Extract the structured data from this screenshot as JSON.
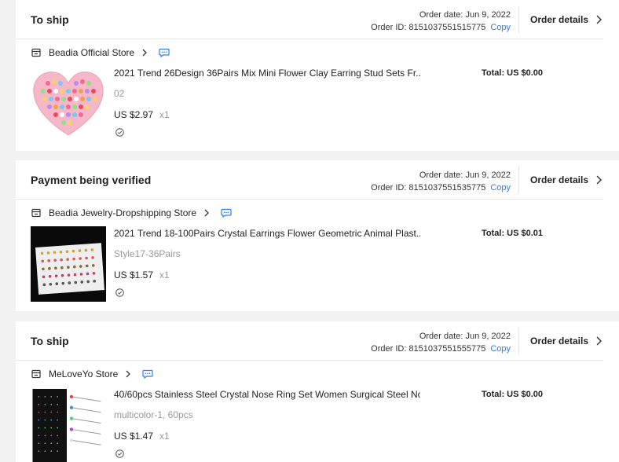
{
  "orders": [
    {
      "status": "To ship",
      "order_date": "Order date: Jun 9, 2022",
      "order_id": "Order ID: 8151037551515775",
      "copy_label": "Copy",
      "details_label": "Order details",
      "store": "Beadia Official Store",
      "product_title": "2021 Trend 26Design 36Pairs Mix Mini Flower Clay Earring Stud Sets Fr...",
      "variant": "02",
      "price": "US $2.97",
      "qty": "x1",
      "total": "Total: US $0.00"
    },
    {
      "status": "Payment being verified",
      "order_date": "Order date: Jun 9, 2022",
      "order_id": "Order ID: 8151037551535775",
      "copy_label": "Copy",
      "details_label": "Order details",
      "store": "Beadia Jewelry-Dropshipping Store",
      "product_title": "2021 Trend 18-100Pairs Crystal Earrings Flower Geometric Animal Plast...",
      "variant": "Style17-36Pairs",
      "price": "US $1.57",
      "qty": "x1",
      "total": "Total: US $0.01"
    },
    {
      "status": "To ship",
      "order_date": "Order date: Jun 9, 2022",
      "order_id": "Order ID: 8151037551555775",
      "copy_label": "Copy",
      "details_label": "Order details",
      "store": "MeLoveYo Store",
      "product_title": "40/60pcs Stainless Steel Crystal Nose Ring Set Women Surgical Steel No...",
      "variant": "multicolor-1, 60pcs",
      "price": "US $1.47",
      "qty": "x1",
      "total": "Total: US $0.00"
    }
  ],
  "colors": {
    "accent": "#2e7cf6",
    "muted": "#999999",
    "background": "#f2f2f2"
  },
  "icons": [
    "store-icon",
    "chevron-right-icon",
    "chat-icon",
    "shield-icon"
  ]
}
